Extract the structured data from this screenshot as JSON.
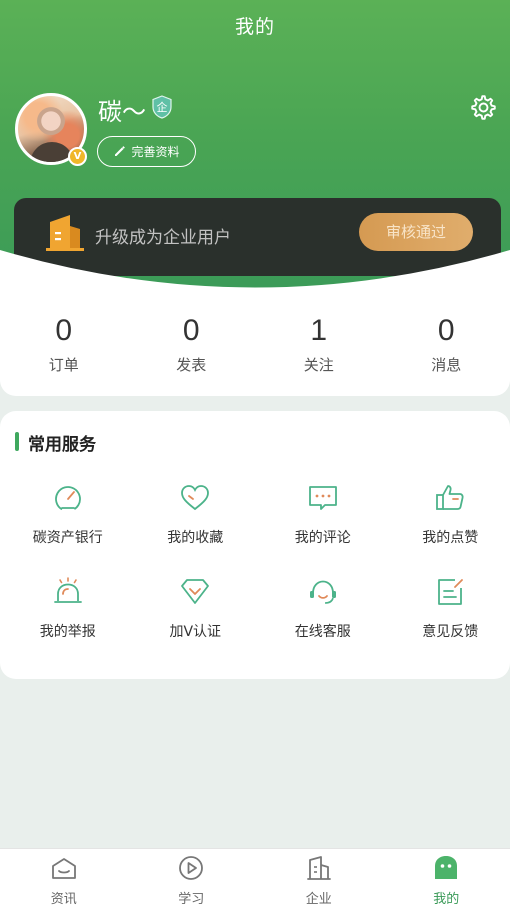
{
  "header": {
    "title": "我的"
  },
  "profile": {
    "username": "碳～",
    "enterprise_badge": "企",
    "verified_badge": "V",
    "edit_label": "完善资料"
  },
  "upgrade": {
    "text": "升级成为企业用户",
    "status_button": "审核通过"
  },
  "stats": [
    {
      "value": "0",
      "label": "订单"
    },
    {
      "value": "0",
      "label": "发表"
    },
    {
      "value": "1",
      "label": "关注"
    },
    {
      "value": "0",
      "label": "消息"
    }
  ],
  "services": {
    "title": "常用服务",
    "items": [
      {
        "label": "碳资产银行",
        "icon": "gauge-icon"
      },
      {
        "label": "我的收藏",
        "icon": "heart-icon"
      },
      {
        "label": "我的评论",
        "icon": "comment-icon"
      },
      {
        "label": "我的点赞",
        "icon": "thumbs-up-icon"
      },
      {
        "label": "我的举报",
        "icon": "alarm-icon"
      },
      {
        "label": "加V认证",
        "icon": "diamond-icon"
      },
      {
        "label": "在线客服",
        "icon": "customer-service-icon"
      },
      {
        "label": "意见反馈",
        "icon": "feedback-icon"
      }
    ]
  },
  "tabs": [
    {
      "label": "资讯",
      "icon": "news-icon",
      "active": false
    },
    {
      "label": "学习",
      "icon": "play-icon",
      "active": false
    },
    {
      "label": "企业",
      "icon": "building-icon",
      "active": false
    },
    {
      "label": "我的",
      "icon": "profile-face-icon",
      "active": true
    }
  ],
  "colors": {
    "brand_green": "#3a9a58",
    "icon_green": "#4cb38a",
    "gold": "#d59a52",
    "dark_card": "#2a302c"
  }
}
